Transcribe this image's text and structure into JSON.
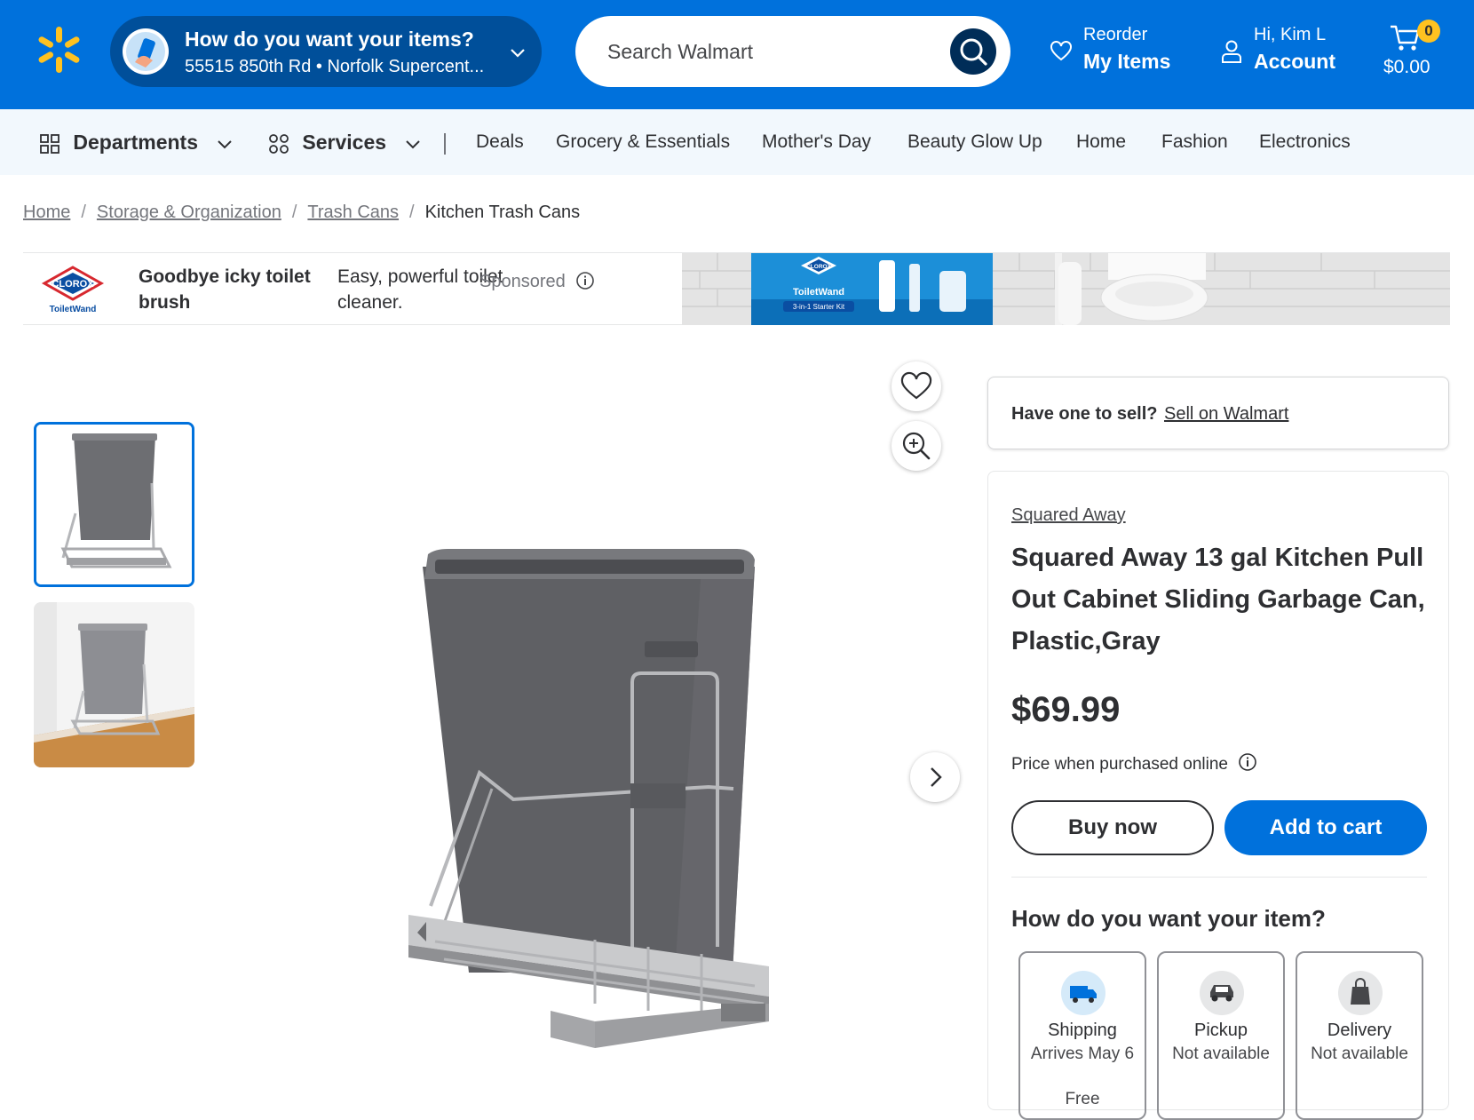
{
  "header": {
    "delivery_title": "How do you want your items?",
    "delivery_address": "55515 850th Rd • Norfolk Supercent...",
    "search_placeholder": "Search Walmart",
    "reorder_top": "Reorder",
    "reorder_bottom": "My Items",
    "account_top": "Hi, Kim L",
    "account_bottom": "Account",
    "cart_count": "0",
    "cart_total": "$0.00",
    "brand_color": "#0071dc",
    "spark_color": "#ffc220"
  },
  "nav": {
    "departments": "Departments",
    "services": "Services",
    "links": [
      "Deals",
      "Grocery & Essentials",
      "Mother's Day",
      "Beauty Glow Up",
      "Home",
      "Fashion",
      "Electronics"
    ]
  },
  "breadcrumb": [
    "Home",
    "Storage & Organization",
    "Trash Cans",
    "Kitchen Trash Cans"
  ],
  "ad": {
    "logo_text": "CLOROX",
    "logo_sub": "ToiletWand",
    "headline": "Goodbye icky toilet brush",
    "body": "Easy, powerful toilet cleaner.",
    "sponsored": "Sponsored",
    "box_logo": "CLOROX",
    "box_name": "ToiletWand",
    "box_kit": "3-in-1 Starter Kit"
  },
  "seller": {
    "question": "Have one to sell?",
    "link": "Sell on Walmart"
  },
  "product": {
    "brand": "Squared Away",
    "title": "Squared Away 13 gal Kitchen Pull Out Cabinet Sliding Garbage Can, Plastic,Gray",
    "price": "$69.99",
    "price_note": "Price when purchased online",
    "buy_now": "Buy now",
    "add_to_cart": "Add to cart",
    "fulfillment_question": "How do you want your item?",
    "options": [
      {
        "name": "Shipping",
        "status": "Arrives May 6",
        "extra": "Free",
        "icon": "truck-icon"
      },
      {
        "name": "Pickup",
        "status": "Not available",
        "extra": "",
        "icon": "car-icon"
      },
      {
        "name": "Delivery",
        "status": "Not available",
        "extra": "",
        "icon": "bag-icon"
      }
    ]
  }
}
